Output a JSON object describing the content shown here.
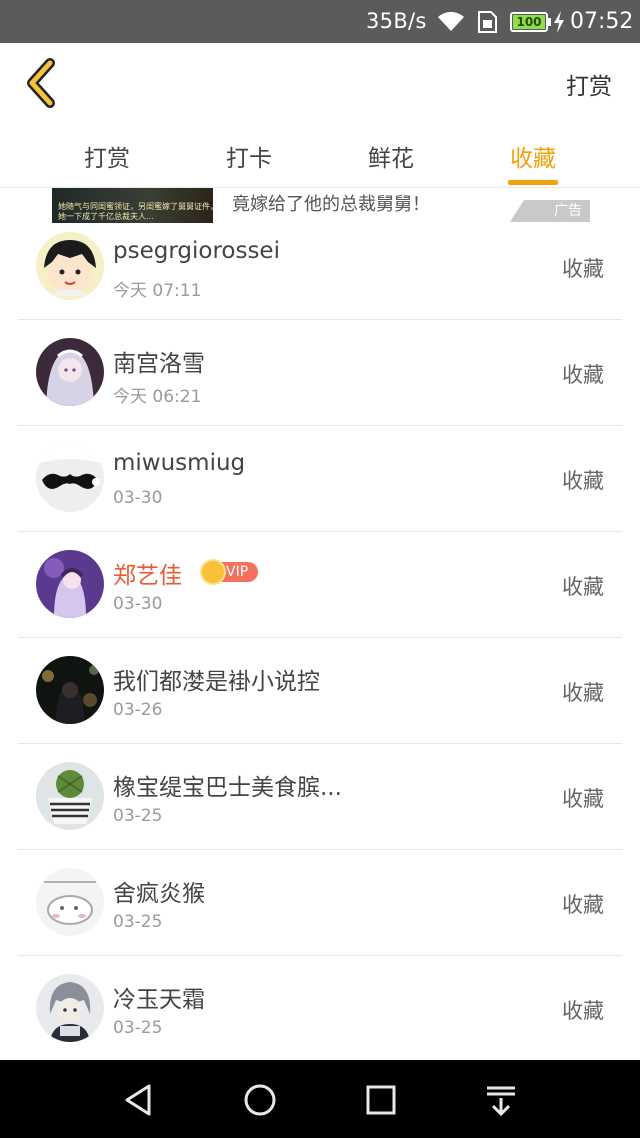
{
  "status_bar": {
    "speed": "35B/s",
    "battery": "100",
    "time": "07:52"
  },
  "header": {
    "action_label": "打赏",
    "accent_color": "#f2a20c"
  },
  "tabs": [
    {
      "label": "打赏"
    },
    {
      "label": "打卡"
    },
    {
      "label": "鲜花"
    },
    {
      "label": "收藏",
      "active": true
    }
  ],
  "ad": {
    "text": "竟嫁给了他的总裁舅舅！",
    "image_caption": "她随气与同闺蜜领证，另闺蜜嫁了舅舅证件，",
    "image_caption2": "她一下成了千亿总裁夫人...",
    "badge": "广告"
  },
  "list": [
    {
      "name": "psegrgiorossei",
      "date": "今天 07:11",
      "action": "收藏"
    },
    {
      "name": "南宫洛雪",
      "date": "今天 06:21",
      "action": "收藏"
    },
    {
      "name": "miwusmiug",
      "date": "03-30",
      "action": "收藏"
    },
    {
      "name": "郑艺佳",
      "date": "03-30",
      "action": "收藏",
      "vip": "VIP"
    },
    {
      "name": "我们都漤是褂小说控",
      "date": "03-26",
      "action": "收藏"
    },
    {
      "name": "橡宝缇宝巴士美食膑...",
      "date": "03-25",
      "action": "收藏"
    },
    {
      "name": "舍疯炎猴",
      "date": "03-25",
      "action": "收藏"
    },
    {
      "name": "冷玉天霜",
      "date": "03-25",
      "action": "收藏"
    }
  ]
}
